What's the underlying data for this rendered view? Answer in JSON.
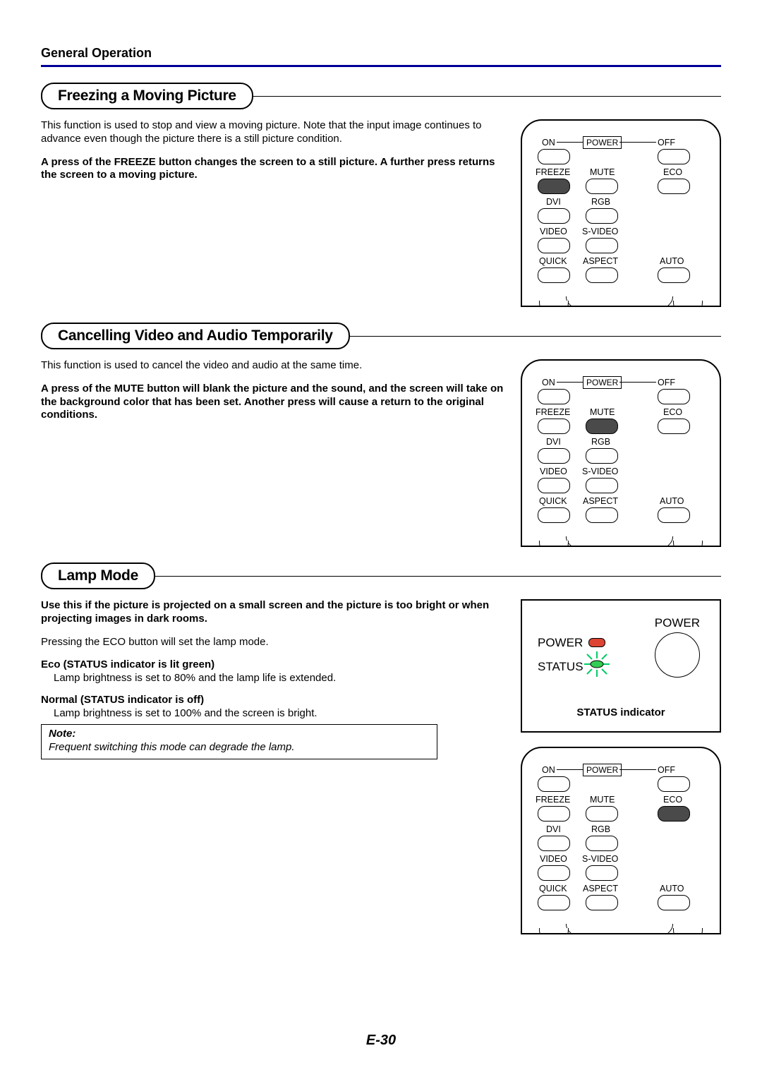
{
  "header": "General Operation",
  "footer": "E-30",
  "sections": {
    "freeze": {
      "title": "Freezing a Moving Picture",
      "p1": "This function is used to stop and view a moving picture. Note that the input image continues to advance even though the picture there is a still picture condition.",
      "p2": "A press of the FREEZE button changes the screen to a still picture. A further press returns the screen to a moving picture."
    },
    "mute": {
      "title": "Cancelling Video and Audio Temporarily",
      "p1": "This function is used to cancel the video and audio at the same time.",
      "p2": "A press of the MUTE button will blank the picture and the sound, and the screen will take on the background color that has been set. Another press will cause a return to the original conditions."
    },
    "lamp": {
      "title": "Lamp Mode",
      "p1": "Use this if the picture is projected on a small screen and the picture is too bright or when projecting images in dark rooms.",
      "p2": "Pressing the ECO button will set the lamp mode.",
      "eco_head": "Eco (STATUS indicator is lit green)",
      "eco_body": "Lamp brightness is set to 80% and the lamp life is extended.",
      "normal_head": "Normal (STATUS indicator is off)",
      "normal_body": "Lamp brightness is set to 100% and the screen is bright.",
      "note_title": "Note:",
      "note_body": "Frequent switching this mode can degrade the lamp."
    }
  },
  "remote": {
    "on": "ON",
    "power": "POWER",
    "off": "OFF",
    "freeze": "FREEZE",
    "mute": "MUTE",
    "eco": "ECO",
    "dvi": "DVI",
    "rgb": "RGB",
    "video": "VIDEO",
    "svideo": "S-VIDEO",
    "quick": "QUICK",
    "aspect": "ASPECT",
    "auto": "AUTO"
  },
  "panel": {
    "power_top": "POWER",
    "power_left": "POWER",
    "status": "STATUS",
    "status_indicator": "STATUS indicator"
  }
}
